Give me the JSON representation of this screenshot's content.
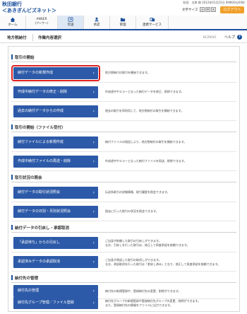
{
  "header": {
    "bank_name": "秋田銀行",
    "service_name": "＜あきぎんビズネット＞",
    "user_info": "秋田　太郎 様",
    "last_login": "2012年01月23日 09時30分00秒",
    "font_size_label": "文字サイズ",
    "font_sizes": [
      "小",
      "中",
      "大"
    ],
    "logout_label": "ログアウト"
  },
  "nav": {
    "items": [
      {
        "label": "ホーム",
        "icon": "home-icon"
      },
      {
        "label": "ANSER",
        "sub": "(アンサー)",
        "icon": "phone-icon"
      },
      {
        "label": "伝送",
        "icon": "transfer-icon",
        "active": true
      },
      {
        "label": "承認",
        "icon": "stamp-icon"
      },
      {
        "label": "管理",
        "icon": "folder-icon"
      },
      {
        "label": "連携サービス",
        "icon": "link-icon"
      }
    ]
  },
  "titlebar": {
    "category": "地方税納付",
    "title": "作業内容選択",
    "screen_code": "BCZN001",
    "help_label": "ヘルプ"
  },
  "sections": {
    "s1": {
      "title": "取引の開始"
    },
    "s2": {
      "title": "取引の開始（ファイル受付）"
    },
    "s3": {
      "title": "取引状況の照会"
    },
    "s4": {
      "title": "納付データの引戻し・承認取消"
    },
    "s5": {
      "title": "納付先の管理"
    }
  },
  "rows": [
    {
      "btn": "納付データの新規作成",
      "desc": "地方税納付の取引を開始できます。"
    },
    {
      "btn": "作成中納付データの修正・削除",
      "desc": "作成途中やエラーとなった納付データを修正、削除できます。"
    },
    {
      "btn": "過去の納付データからの作成",
      "desc": "過去の取引を再利用して、地方税納付の取引を開始できます。"
    },
    {
      "btn": "納付ファイルによる新規作成",
      "desc": "納付ファイルの指定により、地方税納付の取引を開始できます。"
    },
    {
      "btn": "作成中納付ファイルの再送・削除",
      "desc": "作成途中やエラーとなった納付ファイルを再送、削除できます。"
    },
    {
      "btn": "納付データの取引状況照会",
      "desc": "伝送系取引の詳細情報、取引履歴を照会できます。"
    },
    {
      "btn": "納付データの日別・月別状況照会",
      "desc": "過去に行った取引の状況を照会できます。"
    },
    {
      "btn": "「承認待ち」からの引戻し",
      "desc1": "ご自身が依頼した取引の引戻しができます。",
      "desc2": "なお、引戻しを行った取引は、修正して再度承認を依頼できます。"
    },
    {
      "btn": "承認済みデータの承認取消",
      "desc1": "ご自身が承認した取引の取消しができます。",
      "desc2": "なお、承認取消を行った取引は「差戻し済み」となり、修正して再度承認を依頼できます。"
    },
    {
      "btn": "納付先の管理",
      "desc": "納付先の新規登録や、登録納付先の変更、削除ができます。"
    },
    {
      "btn": "納付先グループ管理／ファイル登録",
      "desc1": "納付先グループの新規登録や登録納付先グループの変更、削除ができます。",
      "desc2": "また、登録納付先の情報をファイルに出力できます。"
    }
  ],
  "colors": {
    "accent": "#2d5aa8",
    "brand": "#1a4f9c",
    "logout": "#f0a02a",
    "highlight": "#e02020"
  }
}
